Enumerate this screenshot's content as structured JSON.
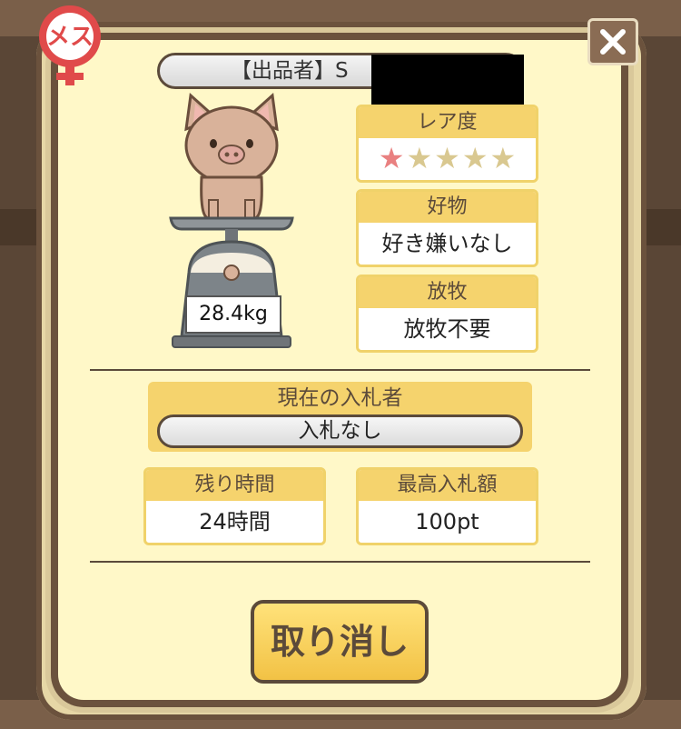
{
  "seller": {
    "label": "【出品者】S"
  },
  "badge": {
    "label": "メス"
  },
  "rarity": {
    "title": "レア度",
    "stars_filled": 1,
    "stars_total": 5
  },
  "favorite": {
    "title": "好物",
    "value": "好き嫌いなし"
  },
  "grazing": {
    "title": "放牧",
    "value": "放牧不要"
  },
  "weight": {
    "value": "28.4kg"
  },
  "current_bidder": {
    "title": "現在の入札者",
    "value": "入札なし"
  },
  "remaining_time": {
    "title": "残り時間",
    "value": "24時間"
  },
  "highest_bid": {
    "title": "最高入札額",
    "value": "100pt"
  },
  "actions": {
    "cancel_label": "取り消し"
  },
  "colors": {
    "accent": "#f5d36d",
    "frame": "#6b523d",
    "panel": "#fff8c8",
    "star_on": "#e98080"
  },
  "icons": {
    "close": "close-icon",
    "gender": "female-symbol-icon",
    "pig": "pig-illustration",
    "scale": "weighing-scale-icon"
  }
}
